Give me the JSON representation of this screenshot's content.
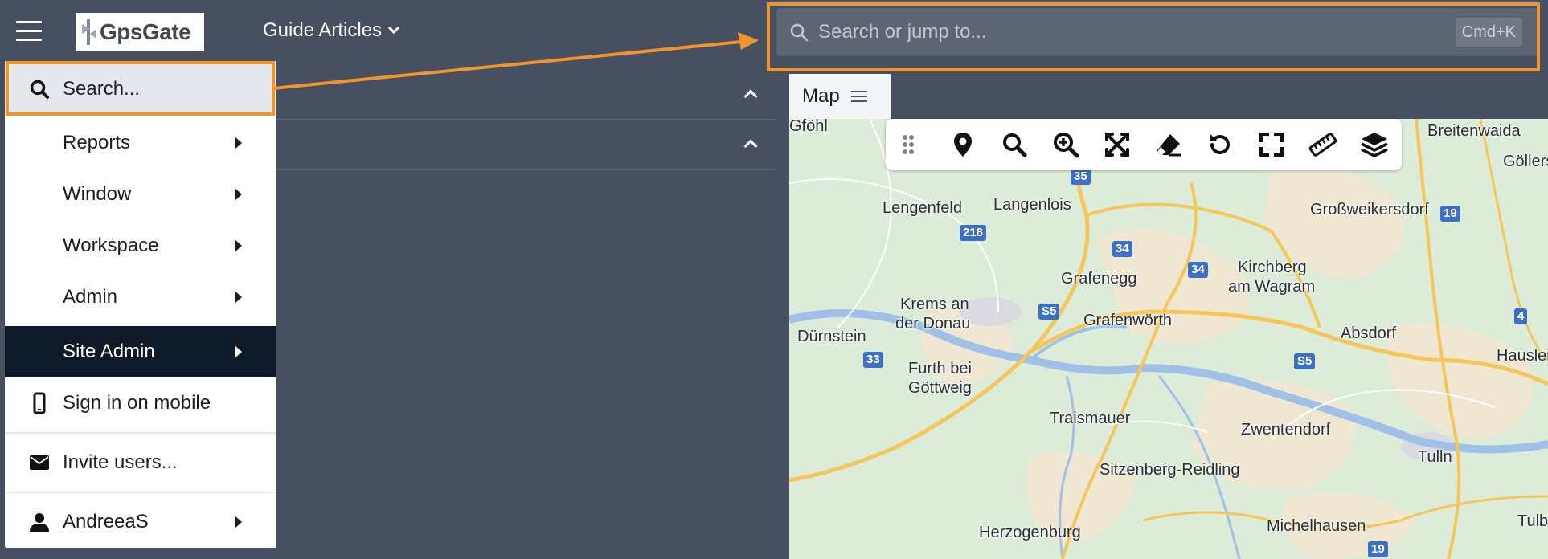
{
  "header": {
    "logo_text": "GpsGate",
    "breadcrumb_label": "Guide Articles",
    "search_placeholder": "Search or jump to...",
    "search_shortcut": "Cmd+K"
  },
  "menu": {
    "items": [
      {
        "label": "Search...",
        "icon": "search-icon"
      },
      {
        "label": "Reports",
        "submenu": true
      },
      {
        "label": "Window",
        "submenu": true
      },
      {
        "label": "Workspace",
        "submenu": true
      },
      {
        "label": "Admin",
        "submenu": true
      },
      {
        "label": "Site Admin",
        "submenu": true,
        "active": true
      },
      {
        "label": "Sign in on mobile",
        "icon": "mobile-icon"
      },
      {
        "label": "Invite users...",
        "icon": "envelope-icon"
      },
      {
        "label": "AndreeaS",
        "icon": "user-icon",
        "submenu": true
      }
    ]
  },
  "map": {
    "tab_label": "Map",
    "tools": [
      "drag-handle-icon",
      "map-pin-icon",
      "search-icon",
      "zoom-in-icon",
      "fit-extent-icon",
      "eraser-icon",
      "reset-icon",
      "fullscreen-icon",
      "ruler-icon",
      "layers-icon"
    ],
    "places": [
      "Gföhl",
      "Lengenfeld",
      "Langenlois",
      "Breitenwaida",
      "Göllers",
      "Großweikersdorf",
      "Grafenegg",
      "Kirchberg",
      "am Wagram",
      "Krems an",
      "der Donau",
      "Grafenwörth",
      "Dürnstein",
      "Absdorf",
      "Hausleit",
      "Furth bei",
      "Göttweig",
      "Traismauer",
      "Zwentendorf",
      "Tulln",
      "Sitzenberg-Reidling",
      "Herzogenburg",
      "Michelhausen",
      "Tulb"
    ],
    "road_shields": [
      "35",
      "218",
      "34",
      "34",
      "19",
      "S5",
      "S5",
      "33",
      "4",
      "19"
    ]
  },
  "colors": {
    "header_bg": "#475060",
    "highlight": "#f0952e",
    "menu_active_bg": "#0f1a28",
    "shield_bg": "#3c6fc6"
  }
}
